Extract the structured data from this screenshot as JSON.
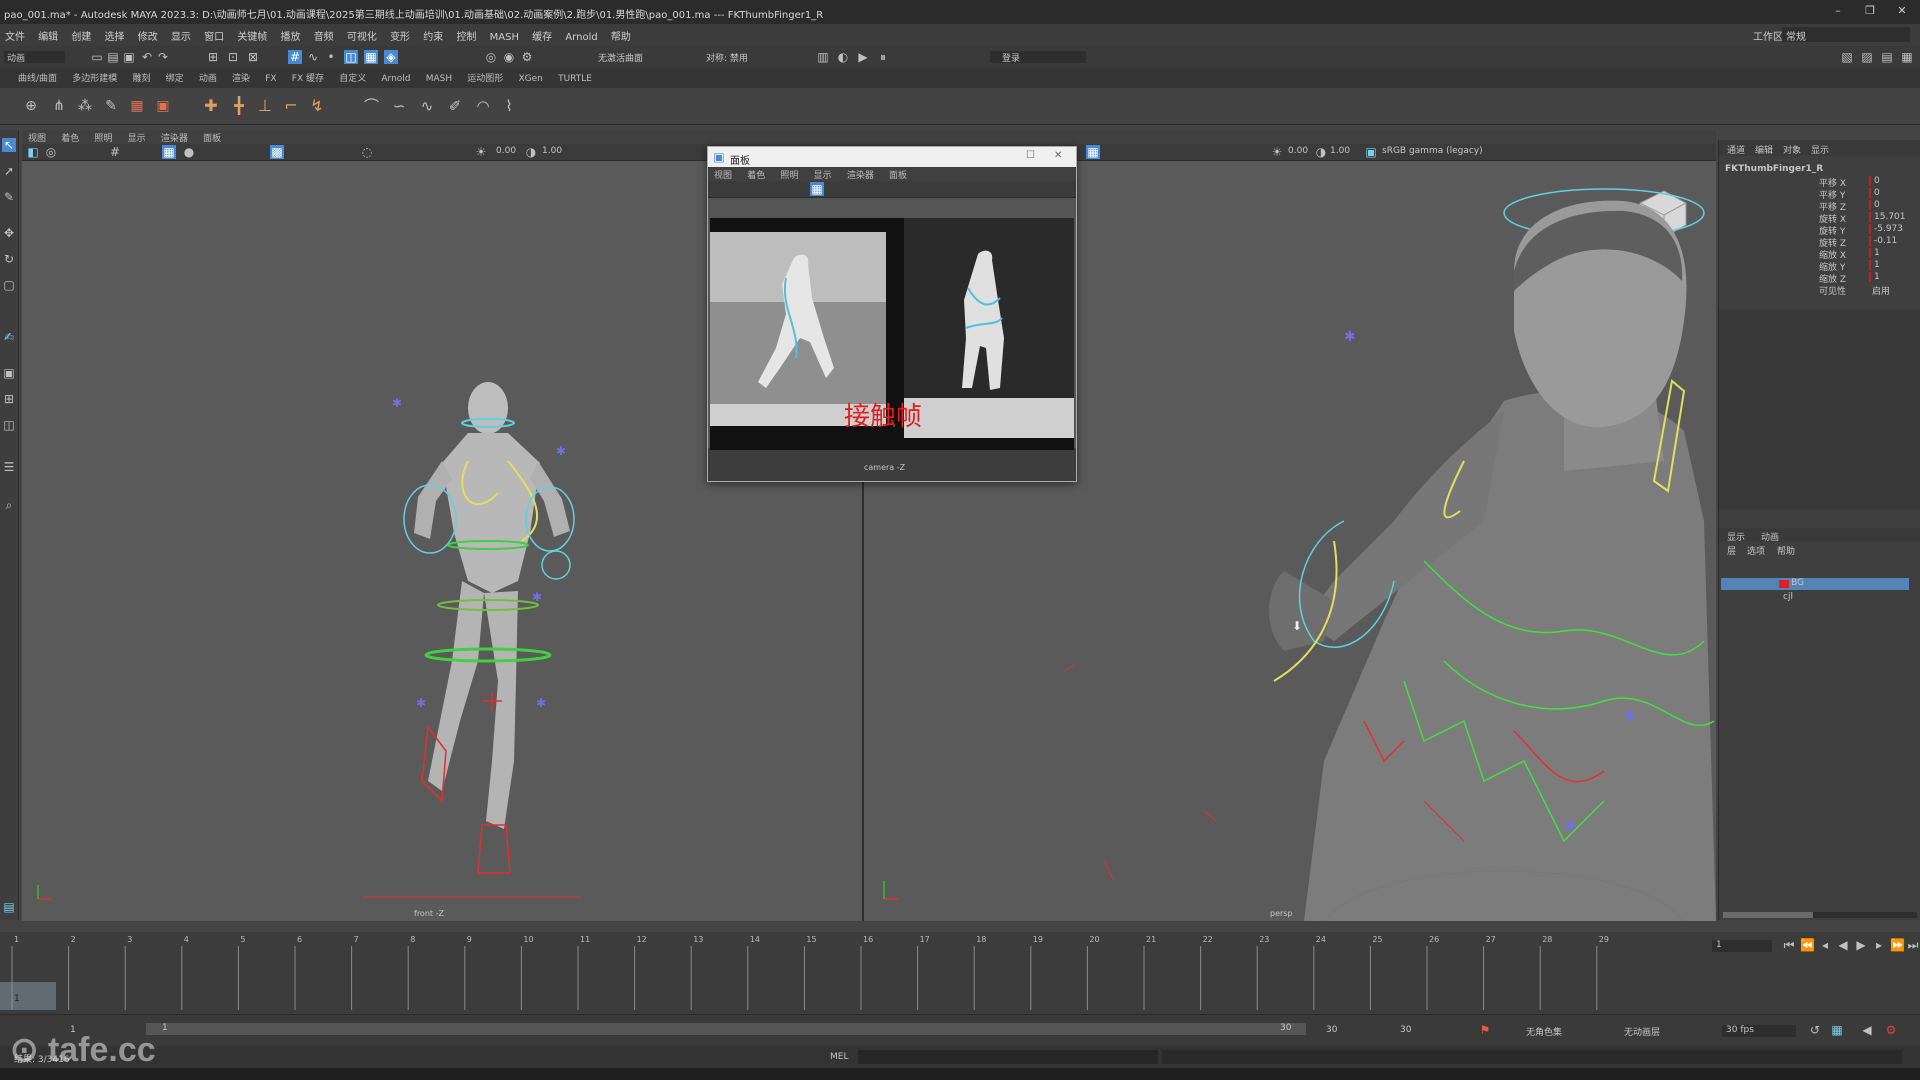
{
  "window": {
    "title": "pao_001.ma* - Autodesk MAYA 2023.3: D:\\动画师七月\\01.动画课程\\2025第三期线上动画培训\\01.动画基础\\02.动画案例\\2.跑步\\01.男性跑\\pao_001.ma   ---   FKThumbFinger1_R",
    "min": "–",
    "restore": "❐",
    "close": "✕"
  },
  "menu": [
    "文件",
    "编辑",
    "创建",
    "选择",
    "修改",
    "显示",
    "窗口",
    "关键帧",
    "播放",
    "音频",
    "可视化",
    "变形",
    "约束",
    "控制",
    "MASH",
    "缓存",
    "Arnold",
    "帮助"
  ],
  "workspace": {
    "label": "工作区:",
    "value": "常规"
  },
  "toolbar": {
    "mode": "动画",
    "live_surface": "无激活曲面",
    "symmetry": "对称: 禁用",
    "login": "登录"
  },
  "shelf_tabs": [
    "曲线/曲面",
    "多边形建模",
    "雕刻",
    "绑定",
    "动画",
    "渲染",
    "FX",
    "FX 缓存",
    "自定义",
    "Arnold",
    "MASH",
    "运动图形",
    "XGen",
    "TURTLE"
  ],
  "left_panel": {
    "menu": [
      "视图",
      "着色",
      "照明",
      "显示",
      "渲染器",
      "面板"
    ],
    "exposure": "0.00",
    "gamma": "1.00",
    "camera_label": "front -Z"
  },
  "float_window": {
    "title": "面板",
    "menu": [
      "视图",
      "着色",
      "照明",
      "显示",
      "渲染器",
      "面板"
    ],
    "reference_caption": "接触帧",
    "camera_label": "camera -Z"
  },
  "right_panel": {
    "exposure": "0.00",
    "gamma": "1.00",
    "colorspace": "sRGB gamma (legacy)",
    "camera_label": "persp"
  },
  "channel_box": {
    "tabs": [
      "通道",
      "编辑",
      "对象",
      "显示"
    ],
    "object": "FKThumbFinger1_R",
    "channels": [
      {
        "name": "平移 X",
        "value": "0"
      },
      {
        "name": "平移 Y",
        "value": "0"
      },
      {
        "name": "平移 Z",
        "value": "0"
      },
      {
        "name": "旋转 X",
        "value": "15.701"
      },
      {
        "name": "旋转 Y",
        "value": "-5.973"
      },
      {
        "name": "旋转 Z",
        "value": "-0.11"
      },
      {
        "name": "缩放 X",
        "value": "1"
      },
      {
        "name": "缩放 Y",
        "value": "1"
      },
      {
        "name": "缩放 Z",
        "value": "1"
      },
      {
        "name": "可见性",
        "value": "启用"
      }
    ],
    "layer_tabs": [
      "显示",
      "动画"
    ],
    "layer_menu": [
      "层",
      "选项",
      "帮助"
    ],
    "layers": [
      {
        "name": "BG",
        "color": "#e02020"
      },
      {
        "name": "cjl",
        "color": ""
      }
    ]
  },
  "timeline": {
    "ticks": [
      "1",
      "2",
      "3",
      "4",
      "5",
      "6",
      "7",
      "8",
      "9",
      "10",
      "11",
      "12",
      "13",
      "14",
      "15",
      "16",
      "17",
      "18",
      "19",
      "20",
      "21",
      "22",
      "23",
      "24",
      "25",
      "26",
      "27",
      "28",
      "29"
    ],
    "current_frame": "1"
  },
  "range": {
    "start": "1",
    "start_inner": "1",
    "end_inner": "30",
    "end": "30",
    "end_outer": "30",
    "char_set": "无角色集",
    "anim_layer": "无动画层",
    "fps": "30 fps"
  },
  "cmdline": {
    "label": "MEL"
  },
  "status": {
    "text": "结果: 3/3416"
  },
  "watermark": "tafe.cc",
  "colors": {
    "accent": "#4a8ad4",
    "title_bg": "#2b2b2b",
    "viewport": "#5a5a5a"
  }
}
